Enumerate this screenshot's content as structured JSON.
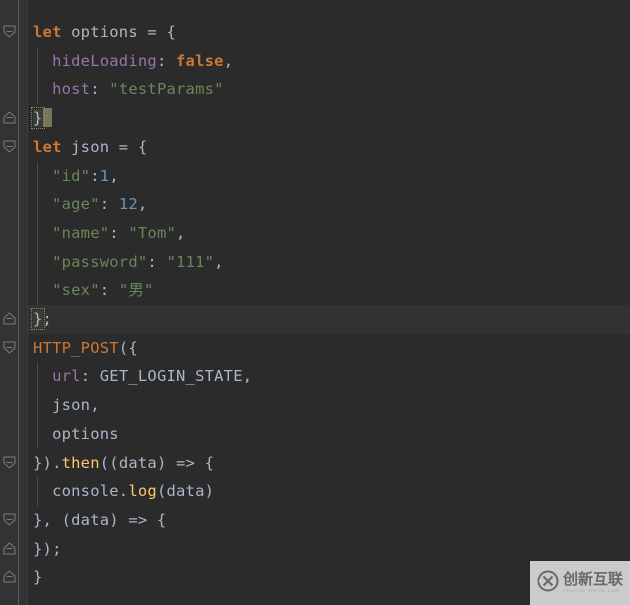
{
  "editor": {
    "theme_name": "darcula",
    "background_color": "#2b2b2b",
    "gutter_color": "#313335",
    "caret_line_color": "#323232",
    "cursor_color": "#787559",
    "line_height_px": 28.7,
    "font_size_px": 15.5,
    "colors": {
      "keyword": "#cc7832",
      "property": "#9876aa",
      "string": "#6a8759",
      "number": "#6897bb",
      "method": "#ffc66d",
      "default_text": "#a9b7c6"
    }
  },
  "code": {
    "language": "javascript",
    "lines": [
      {
        "index": 1,
        "text": "let options = {",
        "indent": 0,
        "fold_marker": "collapse-down",
        "tokens": [
          {
            "t": "let",
            "c": "kw"
          },
          {
            "t": " options = {",
            "c": "ident"
          }
        ]
      },
      {
        "index": 2,
        "text": "  hideLoading: false,",
        "indent": 1,
        "fold_marker": "",
        "tokens": [
          {
            "t": "  ",
            "c": "punc"
          },
          {
            "t": "hideLoading",
            "c": "prop"
          },
          {
            "t": ": ",
            "c": "punc"
          },
          {
            "t": "false",
            "c": "bool"
          },
          {
            "t": ",",
            "c": "punc"
          }
        ]
      },
      {
        "index": 3,
        "text": "  host: \"testParams\"",
        "indent": 1,
        "fold_marker": "",
        "tokens": [
          {
            "t": "  ",
            "c": "punc"
          },
          {
            "t": "host",
            "c": "prop"
          },
          {
            "t": ": ",
            "c": "punc"
          },
          {
            "t": "\"testParams\"",
            "c": "str"
          }
        ]
      },
      {
        "index": 4,
        "text": "}",
        "indent": 0,
        "fold_marker": "expand-up",
        "has_cursor": true,
        "brace_match": true,
        "tokens": [
          {
            "t": "}",
            "c": "punc"
          }
        ]
      },
      {
        "index": 5,
        "text": "let json = {",
        "indent": 0,
        "fold_marker": "collapse-down",
        "tokens": [
          {
            "t": "let",
            "c": "kw"
          },
          {
            "t": " json = {",
            "c": "ident"
          }
        ]
      },
      {
        "index": 6,
        "text": "  \"id\":1,",
        "indent": 1,
        "fold_marker": "",
        "tokens": [
          {
            "t": "  ",
            "c": "punc"
          },
          {
            "t": "\"id\"",
            "c": "str"
          },
          {
            "t": ":",
            "c": "punc"
          },
          {
            "t": "1",
            "c": "num"
          },
          {
            "t": ",",
            "c": "punc"
          }
        ]
      },
      {
        "index": 7,
        "text": "  \"age\": 12,",
        "indent": 1,
        "fold_marker": "",
        "tokens": [
          {
            "t": "  ",
            "c": "punc"
          },
          {
            "t": "\"age\"",
            "c": "str"
          },
          {
            "t": ": ",
            "c": "punc"
          },
          {
            "t": "12",
            "c": "num"
          },
          {
            "t": ",",
            "c": "punc"
          }
        ]
      },
      {
        "index": 8,
        "text": "  \"name\": \"Tom\",",
        "indent": 1,
        "fold_marker": "",
        "tokens": [
          {
            "t": "  ",
            "c": "punc"
          },
          {
            "t": "\"name\"",
            "c": "str"
          },
          {
            "t": ": ",
            "c": "punc"
          },
          {
            "t": "\"Tom\"",
            "c": "str"
          },
          {
            "t": ",",
            "c": "punc"
          }
        ]
      },
      {
        "index": 9,
        "text": "  \"password\": \"111\",",
        "indent": 1,
        "fold_marker": "",
        "tokens": [
          {
            "t": "  ",
            "c": "punc"
          },
          {
            "t": "\"password\"",
            "c": "str"
          },
          {
            "t": ": ",
            "c": "punc"
          },
          {
            "t": "\"111\"",
            "c": "str"
          },
          {
            "t": ",",
            "c": "punc"
          }
        ]
      },
      {
        "index": 10,
        "text": "  \"sex\": \"男\"",
        "indent": 1,
        "fold_marker": "",
        "tokens": [
          {
            "t": "  ",
            "c": "punc"
          },
          {
            "t": "\"sex\"",
            "c": "str"
          },
          {
            "t": ": ",
            "c": "punc"
          },
          {
            "t": "\"男\"",
            "c": "str"
          }
        ]
      },
      {
        "index": 11,
        "text": "};",
        "indent": 0,
        "fold_marker": "expand-up",
        "caret_line": true,
        "brace_match": true,
        "tokens": [
          {
            "t": "}",
            "c": "punc"
          },
          {
            "t": ";",
            "c": "punc"
          }
        ]
      },
      {
        "index": 12,
        "text": "HTTP_POST({",
        "indent": 0,
        "fold_marker": "collapse-down",
        "tokens": [
          {
            "t": "HTTP_POST",
            "c": "fn"
          },
          {
            "t": "({",
            "c": "punc"
          }
        ]
      },
      {
        "index": 13,
        "text": "  url: GET_LOGIN_STATE,",
        "indent": 1,
        "fold_marker": "",
        "tokens": [
          {
            "t": "  ",
            "c": "punc"
          },
          {
            "t": "url",
            "c": "prop"
          },
          {
            "t": ": ",
            "c": "punc"
          },
          {
            "t": "GET_LOGIN_STATE",
            "c": "const"
          },
          {
            "t": ",",
            "c": "punc"
          }
        ]
      },
      {
        "index": 14,
        "text": "  json,",
        "indent": 1,
        "fold_marker": "",
        "tokens": [
          {
            "t": "  json,",
            "c": "ident"
          }
        ]
      },
      {
        "index": 15,
        "text": "  options",
        "indent": 1,
        "fold_marker": "",
        "tokens": [
          {
            "t": "  options",
            "c": "ident"
          }
        ]
      },
      {
        "index": 16,
        "text": "}).then((data) => {",
        "indent": 0,
        "fold_marker": "collapse-down",
        "tokens": [
          {
            "t": "}).",
            "c": "punc"
          },
          {
            "t": "then",
            "c": "method"
          },
          {
            "t": "((data) => {",
            "c": "punc"
          }
        ]
      },
      {
        "index": 17,
        "text": "  console.log(data)",
        "indent": 1,
        "fold_marker": "",
        "tokens": [
          {
            "t": "  console.",
            "c": "ident"
          },
          {
            "t": "log",
            "c": "method"
          },
          {
            "t": "(data)",
            "c": "punc"
          }
        ]
      },
      {
        "index": 18,
        "text": "}, (data) => {",
        "indent": 0,
        "fold_marker": "collapse-down",
        "tokens": [
          {
            "t": "}, (data) => {",
            "c": "punc"
          }
        ]
      },
      {
        "index": 19,
        "text": "});",
        "indent": 0,
        "fold_marker": "expand-up",
        "tokens": [
          {
            "t": "});",
            "c": "punc"
          }
        ]
      },
      {
        "index": 20,
        "text": "}",
        "indent": 0,
        "fold_marker": "expand-up",
        "tokens": [
          {
            "t": "}",
            "c": "punc"
          }
        ]
      }
    ]
  },
  "watermark": {
    "logo_icon": "circle-x-logo-icon",
    "title_cn": "创新互联",
    "subtitle_en": "CHUANG XIN HU LIAN",
    "background_color": "#d8d8d8",
    "title_color": "#6e6e6e"
  }
}
